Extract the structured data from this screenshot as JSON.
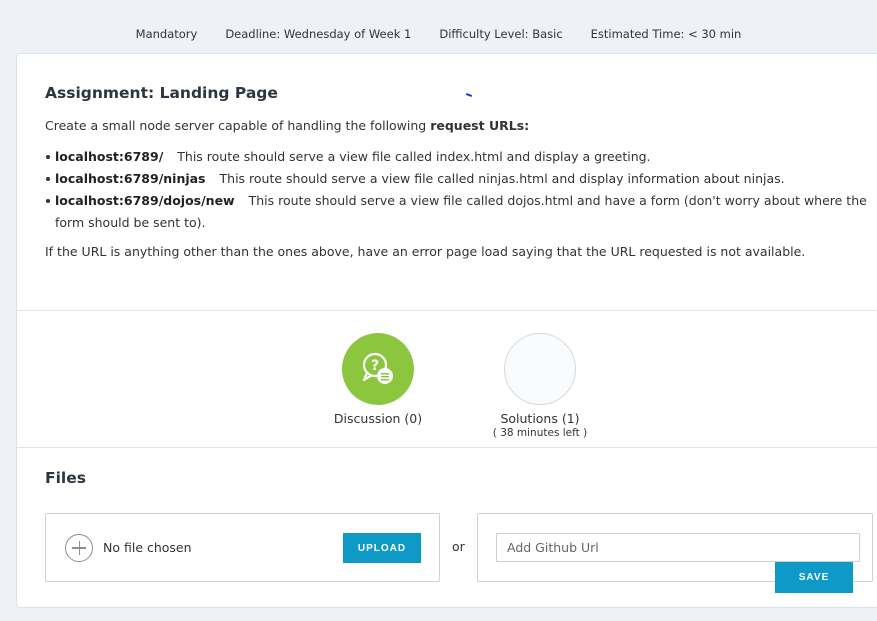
{
  "meta": {
    "mandatory": "Mandatory",
    "deadline": "Deadline: Wednesday of Week 1",
    "difficulty": "Difficulty Level: Basic",
    "time": "Estimated Time: < 30 min"
  },
  "assignment": {
    "title": "Assignment: Landing Page",
    "intro_text": "Create a small node server capable of handling the following ",
    "intro_bold": "request URLs:",
    "routes": [
      {
        "url": "localhost:6789/",
        "desc": "This route should serve a view file called index.html and display a greeting."
      },
      {
        "url": "localhost:6789/ninjas",
        "desc": "This route should serve a view file called ninjas.html and display information about ninjas."
      },
      {
        "url": "localhost:6789/dojos/new",
        "desc": "This route should serve a view file called dojos.html and have a form (don't worry about where the form should be sent to)."
      }
    ],
    "error_note": "If the URL is anything other than the ones above, have an error page load saying that the URL requested is not available."
  },
  "stats": {
    "discussion": {
      "label": "Discussion (0)",
      "icon": "discussion-icon",
      "color": "#8cc63f"
    },
    "solutions": {
      "label": "Solutions (1)",
      "sub": "( 38 minutes left )"
    }
  },
  "files": {
    "title": "Files",
    "file_status": "No file chosen",
    "upload_label": "UPLOAD",
    "or_label": "or",
    "github_placeholder": "Add Github Url",
    "save_label": "SAVE",
    "button_color": "#0e99c7"
  }
}
